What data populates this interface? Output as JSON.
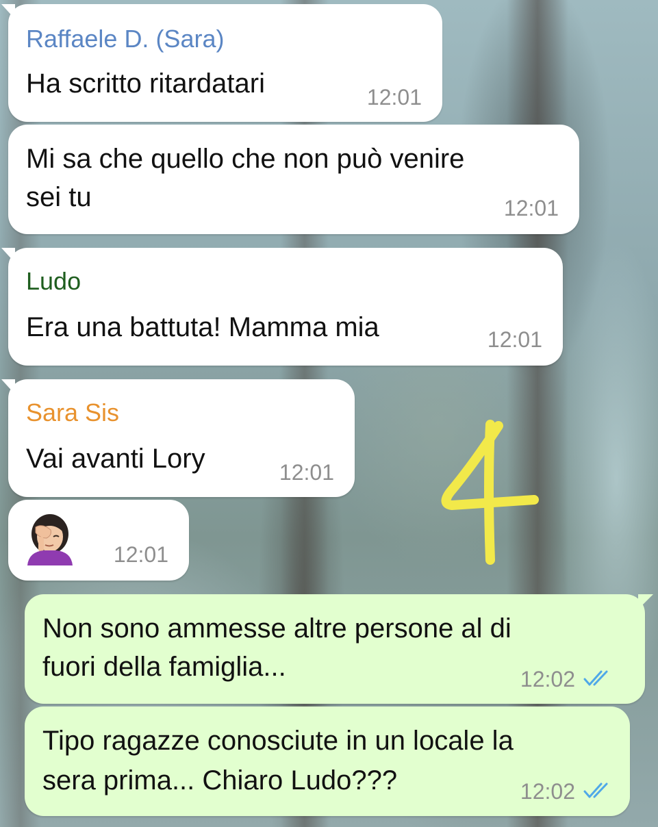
{
  "chat": {
    "messages": [
      {
        "direction": "in",
        "sender": "Raffaele D. (Sara)",
        "sender_color": "#5b86c4",
        "text_lines": [
          "Ha scritto ritardatari"
        ],
        "time": "12:01"
      },
      {
        "direction": "in",
        "sender": "",
        "text_lines": [
          "Mi sa che quello che non può venire",
          "sei tu"
        ],
        "time": "12:01"
      },
      {
        "direction": "in",
        "sender": "Ludo",
        "sender_color": "#1f5e1f",
        "text_lines": [
          "Era una battuta! Mamma mia"
        ],
        "time": "12:01"
      },
      {
        "direction": "in",
        "sender": "Sara Sis",
        "sender_color": "#e8922e",
        "text_lines": [
          "Vai avanti Lory"
        ],
        "time": "12:01"
      },
      {
        "direction": "in",
        "sender": "",
        "emoji": "woman-facepalming-icon",
        "time": "12:01"
      },
      {
        "direction": "out",
        "text_lines": [
          "Non sono ammesse altre persone al di",
          "fuori della famiglia..."
        ],
        "time": "12:02",
        "status": "read"
      },
      {
        "direction": "out",
        "text_lines": [
          "Tipo ragazze conosciute in un locale la",
          "sera prima... Chiaro Ludo???"
        ],
        "time": "12:02",
        "status": "read"
      }
    ]
  },
  "overlay": {
    "handwritten_number": "4",
    "color": "#f2e94a"
  },
  "colors": {
    "incoming_bubble": "#ffffff",
    "outgoing_bubble": "#e2ffcf",
    "read_ticks": "#4fa8e8"
  }
}
